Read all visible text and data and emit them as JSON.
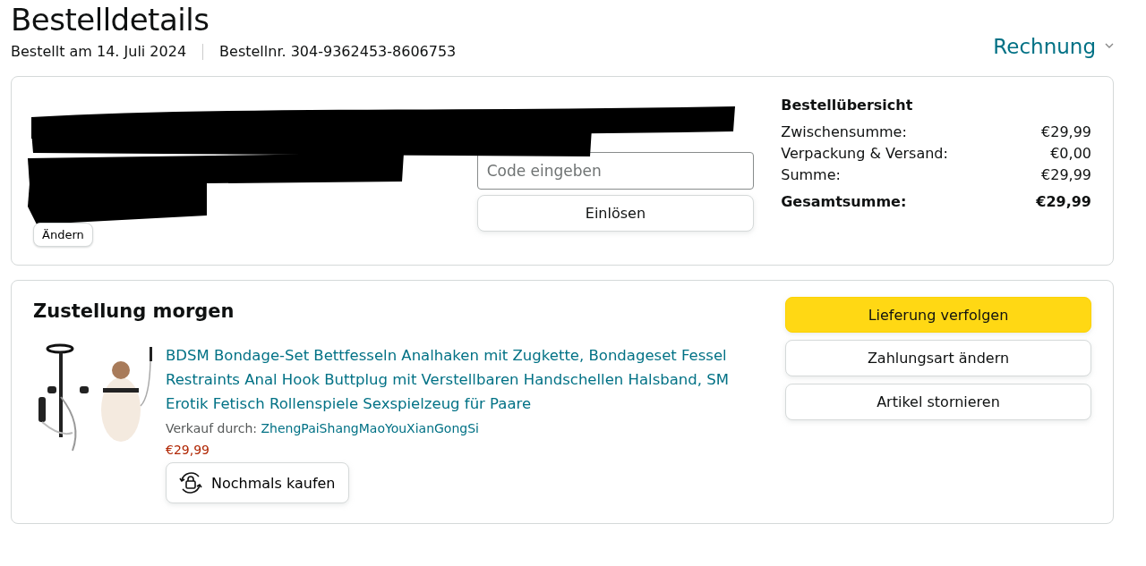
{
  "title": "Bestelldetails",
  "order_date": "Bestellt am 14. Juli 2024",
  "order_number": "Bestellnr. 304-9362453-8606753",
  "invoice_menu": {
    "label": "Rechnung",
    "expanded": false
  },
  "payment": {
    "change_button": "Ändern",
    "code_field": {
      "placeholder": "Code eingeben"
    },
    "redeem_button": "Einlösen"
  },
  "summary": {
    "heading": "Bestellübersicht",
    "rows": [
      {
        "label": "Zwischensumme:",
        "value": "€29,99",
        "kind": "line"
      },
      {
        "label": "Verpackung & Versand:",
        "value": "€0,00",
        "kind": "line"
      },
      {
        "label": "Summe:",
        "value": "€29,99",
        "kind": "line"
      },
      {
        "label": "Gesamtsumme:",
        "value": "€29,99",
        "kind": "total"
      }
    ]
  },
  "shipment": {
    "heading": "Zustellung morgen",
    "item": {
      "kind": "picture",
      "title": "BDSM Bondage-Set Bettfesseln Analhaken mit Zugkette, Bondageset Fessel Restraints Anal Hook Buttplug mit Verstellbaren Handschellen Halsband, SM Erotik Fetisch Rollenspiele Sexspielzeug für Paare",
      "seller_label": "Verkauf durch:",
      "seller": "ZhengPaiShangMaoYouXianGongSi",
      "price": "€29,99",
      "buy_again": "Nochmals kaufen"
    },
    "actions": [
      {
        "label": "Lieferung verfolgen",
        "kind": "primary"
      },
      {
        "label": "Zahlungsart ändern",
        "kind": "secondary"
      },
      {
        "label": "Artikel stornieren",
        "kind": "secondary"
      }
    ]
  }
}
